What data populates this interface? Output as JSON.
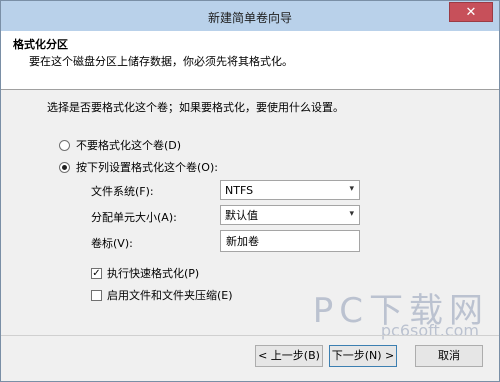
{
  "window": {
    "title": "新建简单卷向导",
    "close_glyph": "✕"
  },
  "header": {
    "title": "格式化分区",
    "subtitle": "要在这个磁盘分区上储存数据，你必须先将其格式化。"
  },
  "instruction": "选择是否要格式化这个卷；如果要格式化，要使用什么设置。",
  "options": [
    {
      "label": "不要格式化这个卷(D)",
      "checked": false
    },
    {
      "label": "按下列设置格式化这个卷(O):",
      "checked": true
    }
  ],
  "fields": {
    "filesystem": {
      "label": "文件系统(F):",
      "value": "NTFS"
    },
    "allocation": {
      "label": "分配单元大小(A):",
      "value": "默认值"
    },
    "volume_label": {
      "label": "卷标(V):",
      "value": "新加卷"
    }
  },
  "checks": [
    {
      "label": "执行快速格式化(P)",
      "checked": true,
      "mark": "✓"
    },
    {
      "label": "启用文件和文件夹压缩(E)",
      "checked": false,
      "mark": ""
    }
  ],
  "buttons": {
    "back": "< 上一步(B)",
    "next": "下一步(N) >",
    "cancel": "取消"
  },
  "watermark": {
    "main": "PC下载网",
    "sub": "pc6soft.com"
  },
  "dropdown_glyph": "▾"
}
